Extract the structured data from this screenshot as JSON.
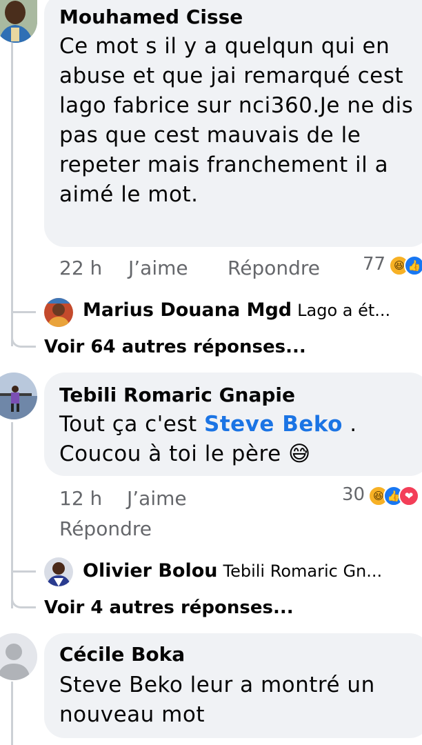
{
  "comments": [
    {
      "author": "Mouhamed Cisse",
      "text": "Ce mot s il y a quelqun qui en abuse et que jai remarqué cest lago fabrice sur nci360.Je ne dis pas que cest mauvais de le repeter mais franchement il a aimé le mot.",
      "time": "22 h",
      "like_label": "J’aime",
      "reply_label": "Répondre",
      "reaction_count": "77",
      "reactions": [
        "haha",
        "like"
      ],
      "reply_preview": {
        "author": "Marius Douana Mgd",
        "snippet": "Lago a ét..."
      },
      "more_replies": "Voir 64 autres réponses..."
    },
    {
      "author": "Tebili Romaric Gnapie",
      "text_before": "Tout ça c'est",
      "mention": "Steve Beko",
      "text_after": ". Coucou à toi le père",
      "emoji": "😅",
      "time": "12 h",
      "like_label": "J’aime",
      "reply_label": "Répondre",
      "reaction_count": "30",
      "reactions": [
        "haha",
        "like",
        "love"
      ],
      "reply_preview": {
        "author": "Olivier Bolou",
        "snippet": "Tebili Romaric Gn..."
      },
      "more_replies": "Voir 4 autres réponses..."
    },
    {
      "author": "Cécile Boka",
      "text": "Steve Beko leur a montré un nouveau mot"
    }
  ],
  "icons": {
    "haha": "😆",
    "like": "👍",
    "love": "❤"
  },
  "colors": {
    "bubble": "#f0f2f5",
    "meta": "#65676b",
    "mention": "#1b74e4",
    "line": "#ccd0d5"
  }
}
